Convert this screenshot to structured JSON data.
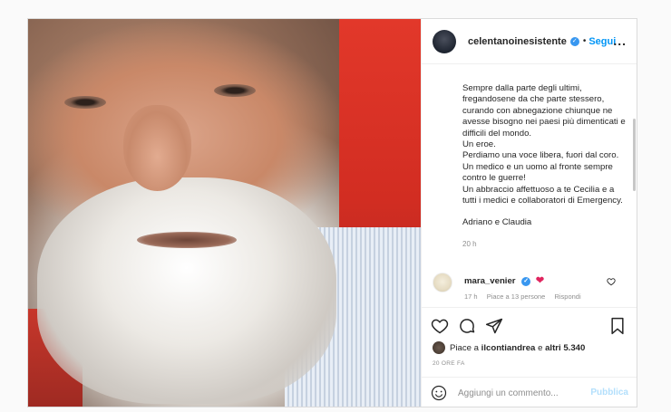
{
  "post": {
    "username": "celentanoinesistente",
    "verified_icon": "verified-badge-icon",
    "separator": "•",
    "follow_label": "Segui",
    "more_label": "..."
  },
  "caption": {
    "lines": [
      "Sempre dalla parte degli ultimi, fregandosene da che parte stessero, curando con abnegazione chiunque ne avesse bisogno nei paesi più dimenticati e difficili del mondo.",
      "Un eroe.",
      "Perdiamo una voce libera, fuori dal coro.",
      "Un medico e un uomo al fronte sempre contro le guerre!",
      "Un abbraccio affettuoso a te Cecilia e a tutti i medici e collaboratori di Emergency."
    ],
    "signoff": "Adriano e Claudia",
    "time": "20 h"
  },
  "comment": {
    "username": "mara_venier",
    "emoji": "❤",
    "time": "17 h",
    "likes": "Piace a 13 persone",
    "reply": "Rispondi"
  },
  "actions": {
    "icons": [
      "heart-icon",
      "comment-icon",
      "share-icon",
      "bookmark-icon"
    ],
    "likes_prefix": "Piace a ",
    "likes_user": "ilcontiandrea",
    "likes_mid": " e ",
    "likes_others": "altri 5.340",
    "posted": "20 ORE FA"
  },
  "add_comment": {
    "placeholder": "Aggiungi un commento...",
    "publish_label": "Pubblica"
  },
  "colors": {
    "accent": "#0095f6",
    "verified": "#3897f0",
    "heart": "#e0245e",
    "publish_disabled": "#b2dffc"
  }
}
